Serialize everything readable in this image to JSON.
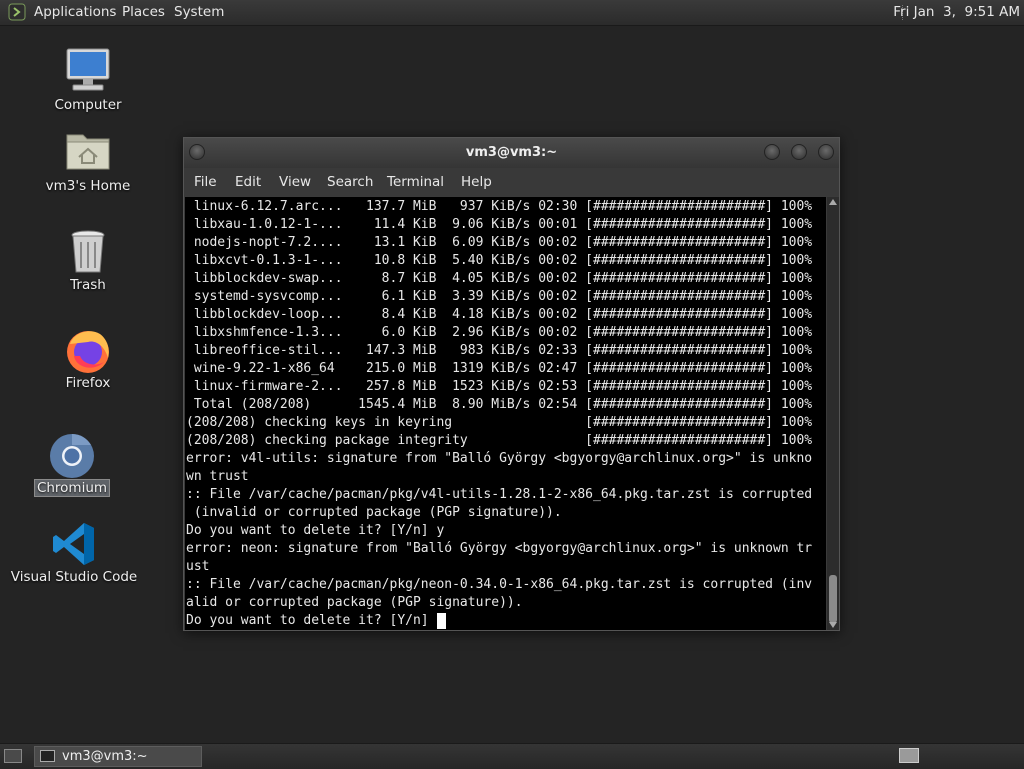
{
  "top_panel": {
    "menus": [
      "Applications",
      "Places",
      "System"
    ],
    "clock": "Fri Jan  3,  9:51 AM"
  },
  "desktop_icons": [
    {
      "label": "Computer",
      "icon": "computer-icon"
    },
    {
      "label": "vm3's Home",
      "icon": "home-folder-icon"
    },
    {
      "label": "Trash",
      "icon": "trash-icon"
    },
    {
      "label": "Firefox",
      "icon": "firefox-icon"
    },
    {
      "label": "Chromium",
      "icon": "chromium-icon"
    },
    {
      "label": "Visual Studio Code",
      "icon": "vscode-icon"
    }
  ],
  "terminal": {
    "title": "vm3@vm3:~",
    "menu": [
      "File",
      "Edit",
      "View",
      "Search",
      "Terminal",
      "Help"
    ],
    "lines": [
      " linux-6.12.7.arc...   137.7 MiB   937 KiB/s 02:30 [######################] 100%",
      " libxau-1.0.12-1-...    11.4 KiB  9.06 KiB/s 00:01 [######################] 100%",
      " nodejs-nopt-7.2....    13.1 KiB  6.09 KiB/s 00:02 [######################] 100%",
      " libxcvt-0.1.3-1-...    10.8 KiB  5.40 KiB/s 00:02 [######################] 100%",
      " libblockdev-swap...     8.7 KiB  4.05 KiB/s 00:02 [######################] 100%",
      " systemd-sysvcomp...     6.1 KiB  3.39 KiB/s 00:02 [######################] 100%",
      " libblockdev-loop...     8.4 KiB  4.18 KiB/s 00:02 [######################] 100%",
      " libxshmfence-1.3...     6.0 KiB  2.96 KiB/s 00:02 [######################] 100%",
      " libreoffice-stil...   147.3 MiB   983 KiB/s 02:33 [######################] 100%",
      " wine-9.22-1-x86_64    215.0 MiB  1319 KiB/s 02:47 [######################] 100%",
      " linux-firmware-2...   257.8 MiB  1523 KiB/s 02:53 [######################] 100%",
      " Total (208/208)      1545.4 MiB  8.90 MiB/s 02:54 [######################] 100%",
      "(208/208) checking keys in keyring                 [######################] 100%",
      "(208/208) checking package integrity               [######################] 100%",
      "error: v4l-utils: signature from \"Balló György <bgyorgy@archlinux.org>\" is unkno",
      "wn trust",
      ":: File /var/cache/pacman/pkg/v4l-utils-1.28.1-2-x86_64.pkg.tar.zst is corrupted",
      " (invalid or corrupted package (PGP signature)).",
      "Do you want to delete it? [Y/n] y",
      "error: neon: signature from \"Balló György <bgyorgy@archlinux.org>\" is unknown tr",
      "ust",
      ":: File /var/cache/pacman/pkg/neon-0.34.0-1-x86_64.pkg.tar.zst is corrupted (inv",
      "alid or corrupted package (PGP signature)).",
      "Do you want to delete it? [Y/n] "
    ]
  },
  "taskbar": {
    "window_button": "vm3@vm3:~"
  },
  "colors": {
    "desktop_bg": "#242424",
    "terminal_bg": "#000000",
    "terminal_fg": "#e8e8e8"
  }
}
